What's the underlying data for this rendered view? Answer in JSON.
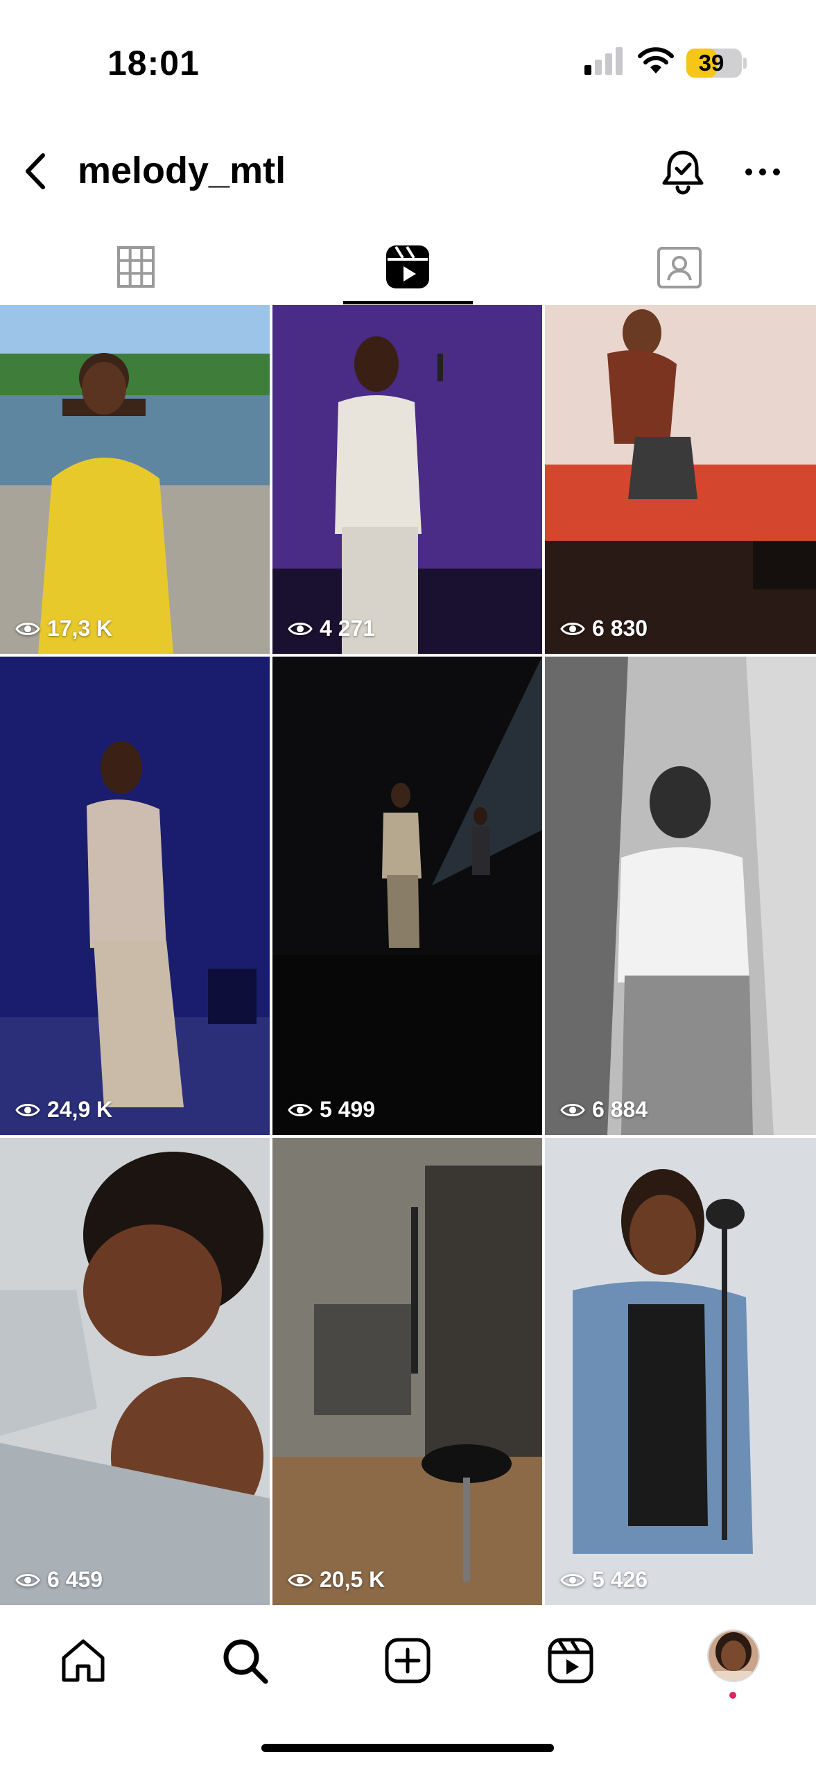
{
  "status_bar": {
    "time": "18:01",
    "battery": "39",
    "battery_level": 0.39
  },
  "header": {
    "username": "melody_mtl"
  },
  "tabs": [
    {
      "name": "grid-icon"
    },
    {
      "name": "reels-icon",
      "selected": true
    },
    {
      "name": "tagged-icon"
    }
  ],
  "reels": [
    {
      "views": "17,3 K"
    },
    {
      "views": "4 271"
    },
    {
      "views": "6 830"
    },
    {
      "views": "24,9 K"
    },
    {
      "views": "5 499"
    },
    {
      "views": "6 884"
    },
    {
      "views": "6 459"
    },
    {
      "views": "20,5 K"
    },
    {
      "views": "5 426"
    }
  ],
  "bottom_nav": [
    "home-icon",
    "search-icon",
    "create-icon",
    "reels-icon",
    "profile-avatar"
  ],
  "colors": {
    "accent_dot": "#e0245e",
    "battery_yellow": "#f5c518"
  }
}
